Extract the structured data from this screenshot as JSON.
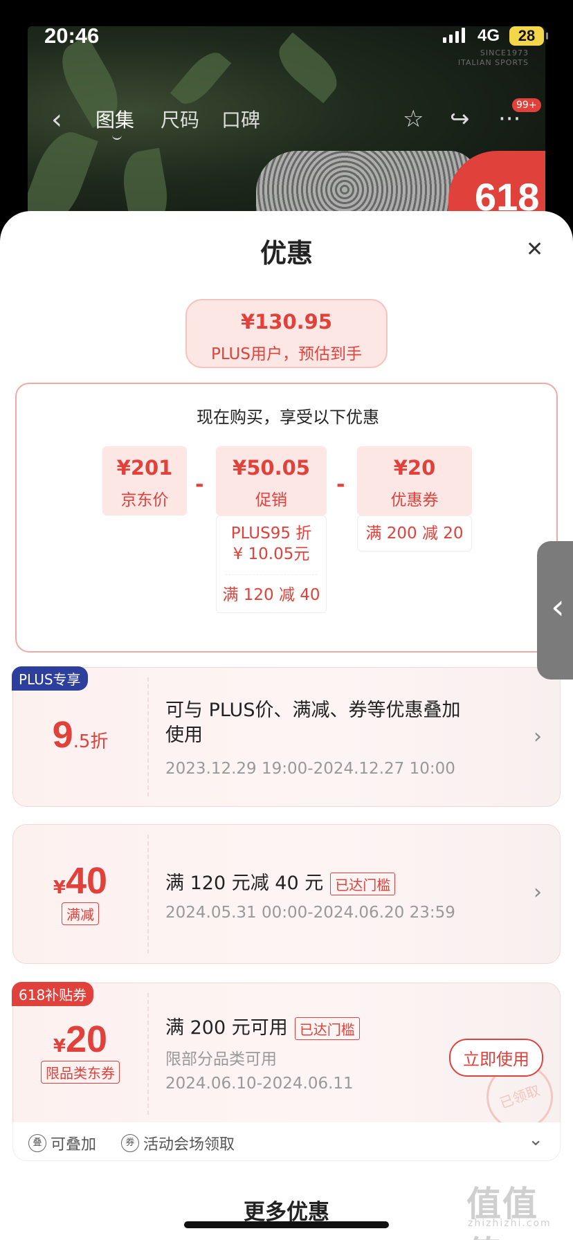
{
  "status": {
    "time": "20:46",
    "network": "4G",
    "battery": "28"
  },
  "background": {
    "brand_line1": "SINCE1973",
    "brand_line2": "ITALIAN SPORTS",
    "badge": "618"
  },
  "nav": {
    "tabs": [
      "图集",
      "尺码",
      "口碑"
    ],
    "badge": "99+"
  },
  "sheet": {
    "title": "优惠"
  },
  "estimate": {
    "price": "¥130.95",
    "label": "PLUS用户，预估到手"
  },
  "calc": {
    "heading": "现在购买，享受以下优惠",
    "items": [
      {
        "value": "¥201",
        "label": "京东价"
      },
      {
        "value": "¥50.05",
        "label": "促销"
      },
      {
        "value": "¥20",
        "label": "优惠券"
      }
    ],
    "minus": "-",
    "promo_details": [
      "PLUS95 折",
      "¥ 10.05元",
      "满 120 减 40"
    ],
    "coupon_details": [
      "满 200 减 20"
    ]
  },
  "coupons": [
    {
      "tag": "PLUS专享",
      "big": "9",
      "unit": ".5折",
      "title_line1": "可与 PLUS价、满减、券等优惠叠加",
      "title_line2": "使用",
      "period": "2023.12.29 19:00-2024.12.27 10:00"
    },
    {
      "yen": "¥",
      "big": "40",
      "chip": "满减",
      "title": "满 120 元减 40 元",
      "reach": "已达门槛",
      "period": "2024.05.31 00:00-2024.06.20 23:59"
    },
    {
      "tag": "618补贴券",
      "yen": "¥",
      "big": "20",
      "chip": "限品类东券",
      "title": "满 200 元可用",
      "reach": "已达门槛",
      "limit": "限部分品类可用",
      "period": "2024.06.10-2024.06.11",
      "button": "立即使用",
      "stamp": "已领取"
    }
  ],
  "footer": {
    "stackable": "可叠加",
    "stack_icon": "叠",
    "source": "活动会场领取",
    "source_icon": "券"
  },
  "more": {
    "title": "更多优惠"
  },
  "watermark": {
    "main": "值值值",
    "sub": "zhizhizhi.com"
  }
}
